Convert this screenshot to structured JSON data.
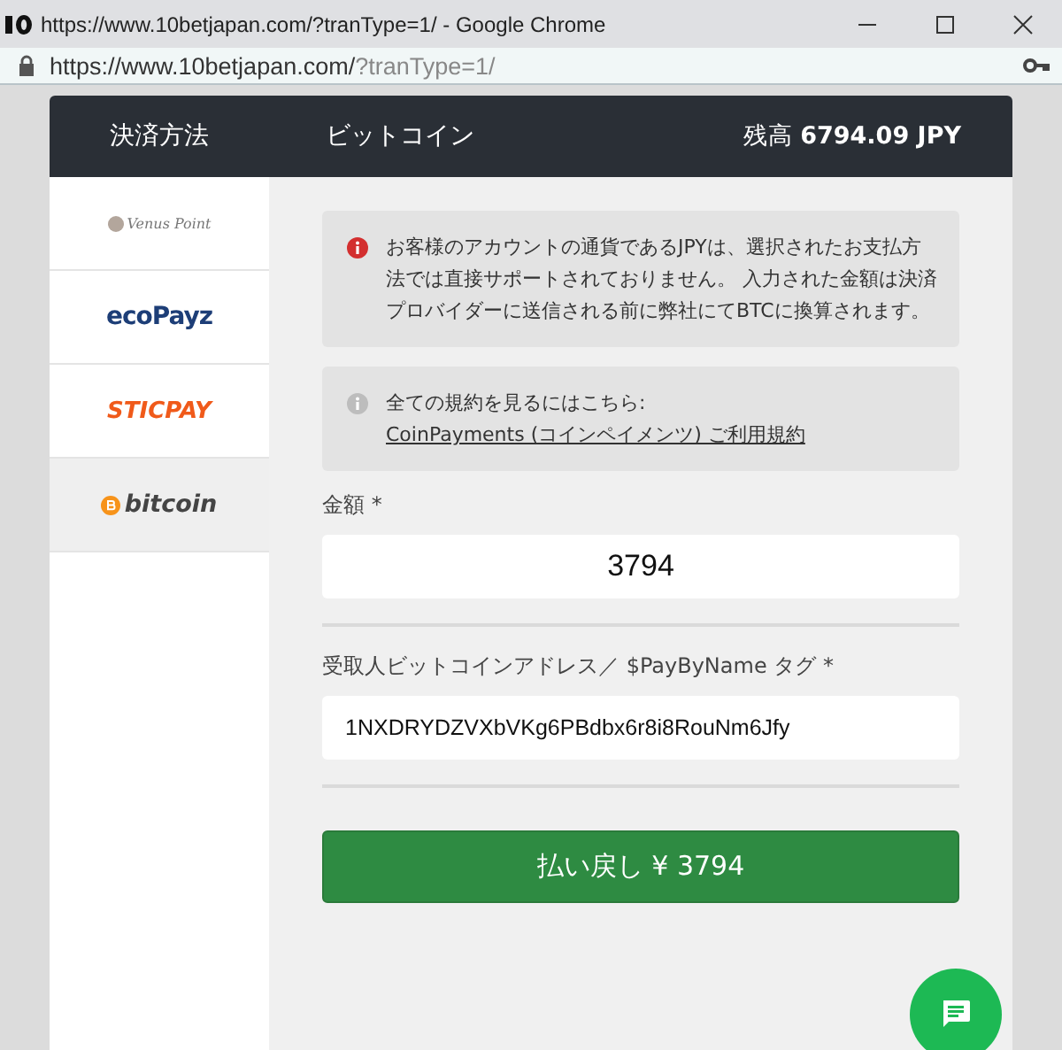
{
  "window": {
    "title": "https://www.10betjapan.com/?tranType=1/ - Google Chrome"
  },
  "address_bar": {
    "host": "https://www.10betjapan.com/",
    "path": "?tranType=1/"
  },
  "header": {
    "section": "決済方法",
    "method": "ビットコイン",
    "balance_label": "残高",
    "balance": "6794.09 JPY"
  },
  "sidebar": {
    "items": [
      {
        "kind": "venus",
        "label": "Venus Point",
        "selected": false
      },
      {
        "kind": "ecopayz",
        "label": "ecoPayz",
        "selected": false
      },
      {
        "kind": "sticpay",
        "label": "STICPAY",
        "selected": false
      },
      {
        "kind": "bitcoin",
        "label": "bitcoin",
        "selected": true
      }
    ]
  },
  "notices": [
    {
      "kind": "error",
      "text": "お客様のアカウントの通貨であるJPYは、選択されたお支払方法では直接サポートされておりません。 入力された金額は決済プロバイダーに送信される前に弊社にてBTCに換算されます。"
    },
    {
      "kind": "info",
      "text": "全ての規約を見るにはこちら: ",
      "link": "CoinPayments (コインペイメンツ) ご利用規約"
    }
  ],
  "fields": [
    {
      "kind": "amount",
      "label": "金額 *",
      "value": "3794"
    },
    {
      "label": "受取人ビットコインアドレス／ $PayByName タグ *",
      "value": "1NXDRYDZVXbVKg6PBdbx6r8i8RouNm6Jfy",
      "kind": "address"
    }
  ],
  "submit_button": "払い戻し ¥ 3794"
}
